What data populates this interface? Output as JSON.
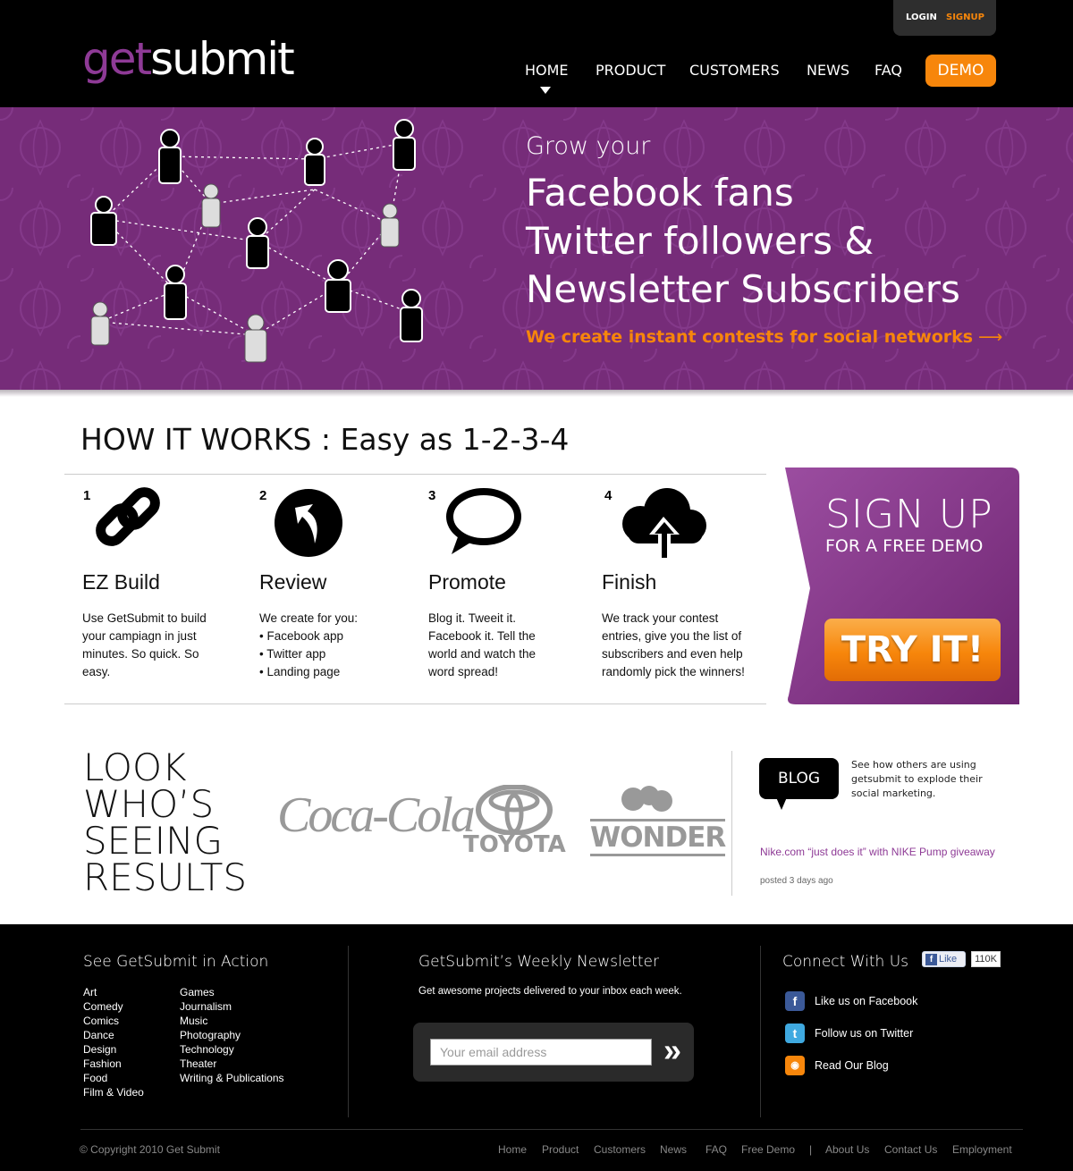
{
  "header": {
    "logo_get": "get",
    "logo_submit": "submit",
    "login": "LOGIN",
    "signup": "SIGNUP",
    "nav": [
      "HOME",
      "PRODUCT",
      "CUSTOMERS",
      "NEWS",
      "FAQ"
    ],
    "demo": "DEMO"
  },
  "hero": {
    "line1": "Grow your",
    "line2": "Facebook fans",
    "line3": "Twitter followers &",
    "line4": "Newsletter Subscribers",
    "tagline": "We create instant contests for social networks"
  },
  "how": {
    "title": "HOW IT WORKS : Easy as 1-2-3-4",
    "steps": [
      {
        "num": "1",
        "title": "EZ Build",
        "icon": "link-icon",
        "desc": "Use GetSubmit to build\nyour campiagn in just\nminutes. So quick. So\neasy."
      },
      {
        "num": "2",
        "title": "Review",
        "icon": "review-arrow-icon",
        "desc": "We create for you:\n• Facebook app\n• Twitter app\n• Landing page"
      },
      {
        "num": "3",
        "title": "Promote",
        "icon": "speech-bubble-icon",
        "desc": "Blog it. Tweeit it.\nFacebook it. Tell the\nworld and watch the\nword spread!"
      },
      {
        "num": "4",
        "title": "Finish",
        "icon": "cloud-upload-icon",
        "desc": "We track your contest\nentries, give you the list of\nsubscribers and even help\nrandomly pick the winners!"
      }
    ]
  },
  "signup_panel": {
    "big": "SIGN UP",
    "small": "FOR A FREE DEMO",
    "button": "TRY IT!"
  },
  "results": {
    "title": "LOOK\nWHO’S\nSEEING\nRESULTS",
    "brands": [
      "Coca-Cola",
      "TOYOTA",
      "WONDER"
    ]
  },
  "blog": {
    "label": "BLOG",
    "desc": "See how others are using getsubmit to explode their social marketing.",
    "link": "Nike.com “just does it” with NIKE Pump giveaway",
    "date": "posted 3 days ago"
  },
  "footer": {
    "action_title": "See GetSubmit in Action",
    "categories_col1": [
      "Art",
      "Comedy",
      "Comics",
      "Dance",
      "Design",
      "Fashion",
      "Food",
      "Film & Video"
    ],
    "categories_col2": [
      "Games",
      "Journalism",
      "Music",
      "Photography",
      "Technology",
      "Theater",
      "Writing & Publications"
    ],
    "newsletter_title": "GetSubmit’s Weekly Newsletter",
    "newsletter_desc": "Get awesome projects delivered to your inbox each week.",
    "email_placeholder": "Your email address",
    "connect_title": "Connect With Us",
    "fb_like": "Like",
    "fb_count": "110K",
    "social": [
      {
        "label": "Like us on Facebook",
        "icon": "facebook-icon",
        "color": "#3b5998"
      },
      {
        "label": "Follow us on Twitter",
        "icon": "twitter-icon",
        "color": "#3fa9e0"
      },
      {
        "label": "Read Our Blog",
        "icon": "rss-icon",
        "color": "#f7860b"
      }
    ],
    "copyright": "© Copyright 2010 Get Submit",
    "links": [
      "Home",
      "Product",
      "Customers",
      "News",
      "FAQ",
      "Free Demo",
      "|",
      "About Us",
      "Contact Us",
      "Employment"
    ]
  },
  "colors": {
    "brand_purple": "#762c79",
    "brand_orange": "#f7860b",
    "header_bg": "#000000"
  }
}
